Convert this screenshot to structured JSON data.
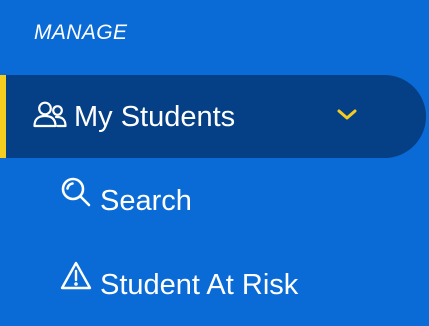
{
  "section": {
    "title": "MANAGE"
  },
  "nav": {
    "parent": {
      "label": "My Students",
      "icon": "users-icon",
      "expand_icon": "chevron-down-icon"
    },
    "children": [
      {
        "label": "Search",
        "icon": "search-icon"
      },
      {
        "label": "Student At Risk",
        "icon": "warning-icon"
      }
    ]
  },
  "colors": {
    "sidebar_bg": "#0a6ad6",
    "active_bg": "#053f86",
    "accent": "#f4cd1f",
    "text": "#ffffff"
  }
}
